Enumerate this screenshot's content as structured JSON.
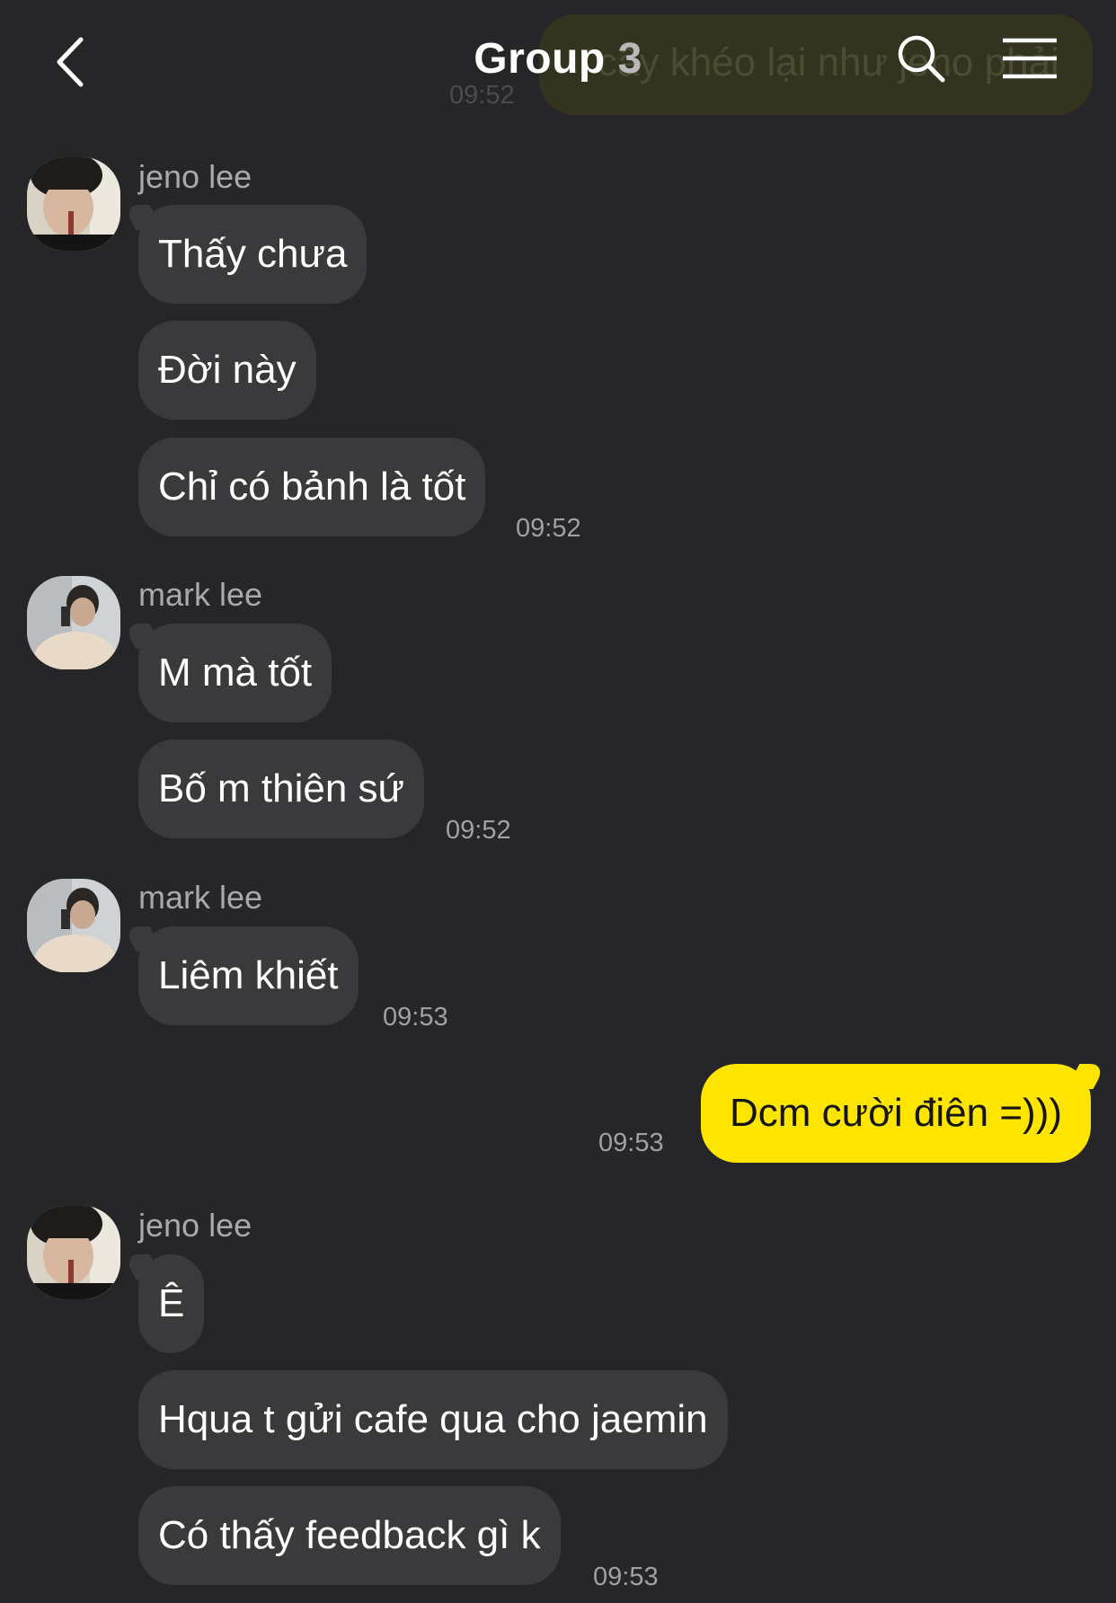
{
  "header": {
    "title": "Group",
    "member_count": "3",
    "background_preview_text": "cây khéo lại như jeno phải",
    "background_preview_time": "09:52"
  },
  "icons": {
    "back": "chevron-left-icon",
    "search": "search-icon",
    "menu": "hamburger-menu-icon"
  },
  "colors": {
    "background": "#262629",
    "incoming_bubble": "#3a3a3d",
    "outgoing_bubble": "#fee500"
  },
  "messages": [
    {
      "sender": "jeno lee",
      "time": "09:52",
      "texts": [
        "Thấy chưa",
        "Đời này",
        "Chỉ có bảnh là tốt"
      ]
    },
    {
      "sender": "mark lee",
      "time": "09:52",
      "texts": [
        "M mà tốt",
        "Bố m thiên sứ"
      ]
    },
    {
      "sender": "mark lee",
      "time": "09:53",
      "texts": [
        "Liêm khiết"
      ]
    },
    {
      "sender": "me",
      "time": "09:53",
      "texts": [
        "Dcm cười điên =)))"
      ]
    },
    {
      "sender": "jeno lee",
      "time": "09:53",
      "texts": [
        "Ê",
        "Hqua t gửi cafe qua cho jaemin",
        "Có thấy feedback gì k"
      ]
    }
  ]
}
